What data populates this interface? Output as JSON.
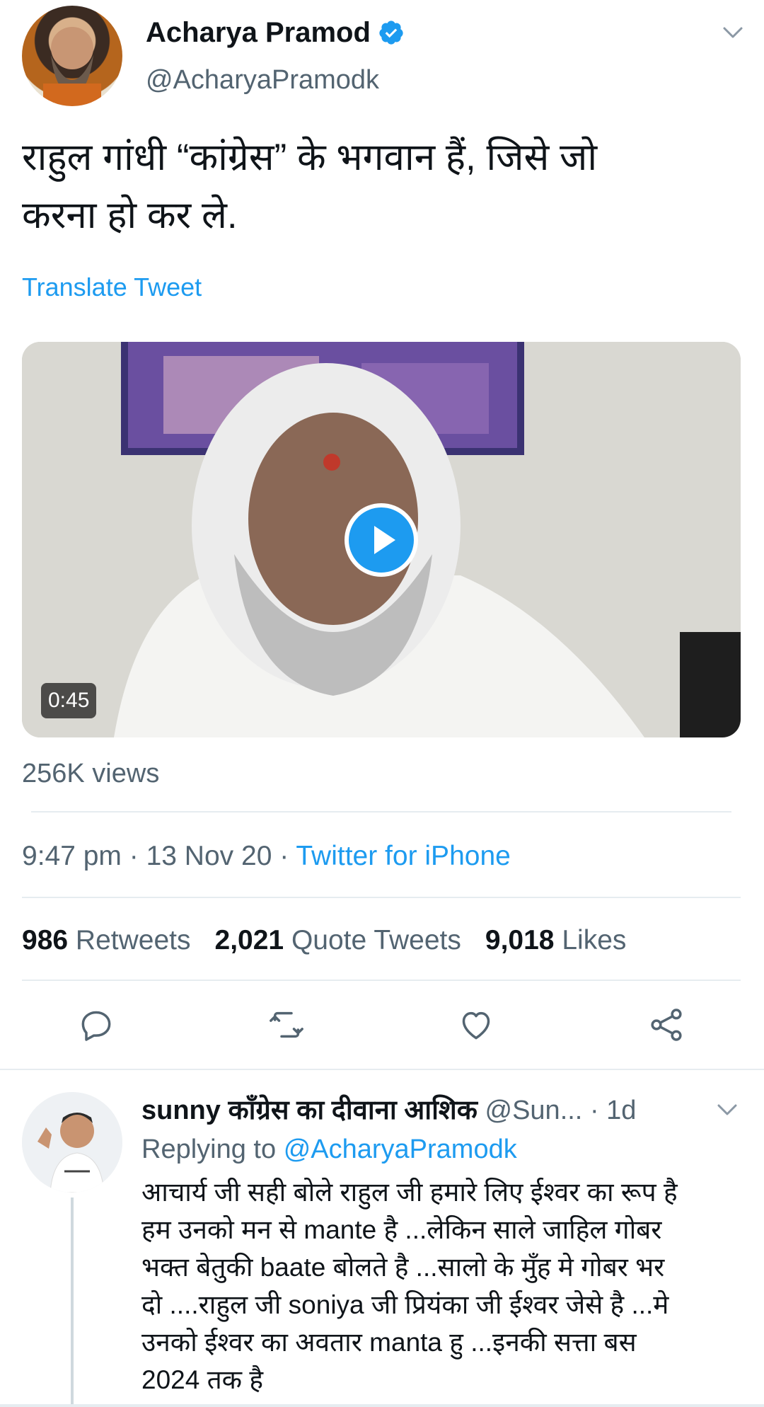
{
  "tweet": {
    "author_name": "Acharya Pramod",
    "author_handle": "@AcharyaPramodk",
    "text_line1": "राहुल गांधी “कांग्रेस” के भगवान हैं, जिसे जो",
    "text_line2": "करना हो कर ले.",
    "translate_label": "Translate Tweet",
    "video_duration": "0:45",
    "views": "256K views",
    "time": "9:47 pm",
    "date": "13 Nov 20",
    "source": "Twitter for iPhone",
    "retweets_count": "986",
    "retweets_label": "Retweets",
    "quotes_count": "2,021",
    "quotes_label": "Quote Tweets",
    "likes_count": "9,018",
    "likes_label": "Likes"
  },
  "reply": {
    "author_name": "sunny कॉंग्रेस का दीवाना आशिक",
    "author_handle": "@Sun...",
    "age": "· 1d",
    "replying_prefix": "Replying to",
    "replying_handle": "@AcharyaPramodk",
    "lines": [
      "आचार्य जी सही बोले राहुल जी  हमारे लिए ईश्वर का रूप है",
      "हम उनको मन से mante है  ...लेकिन साले जाहिल गोबर",
      "भक्त बेतुकी baate बोलते है ...सालो के मुँह मे गोबर भर",
      "दो ....राहुल जी soniya जी प्रियंका जी ईश्वर जेसे है ...मे",
      "उनको ईश्वर का अवतार manta हु ...इनकी सत्ता बस",
      "2024 तक है"
    ]
  },
  "icons": [
    "verified-badge-icon",
    "chevron-down-icon",
    "play-icon",
    "reply-icon",
    "retweet-icon",
    "like-icon",
    "share-icon"
  ],
  "colors": {
    "accent": "#1d9bf0",
    "text": "#0f1419",
    "muted": "#536471",
    "divider": "#e6ecf0"
  }
}
